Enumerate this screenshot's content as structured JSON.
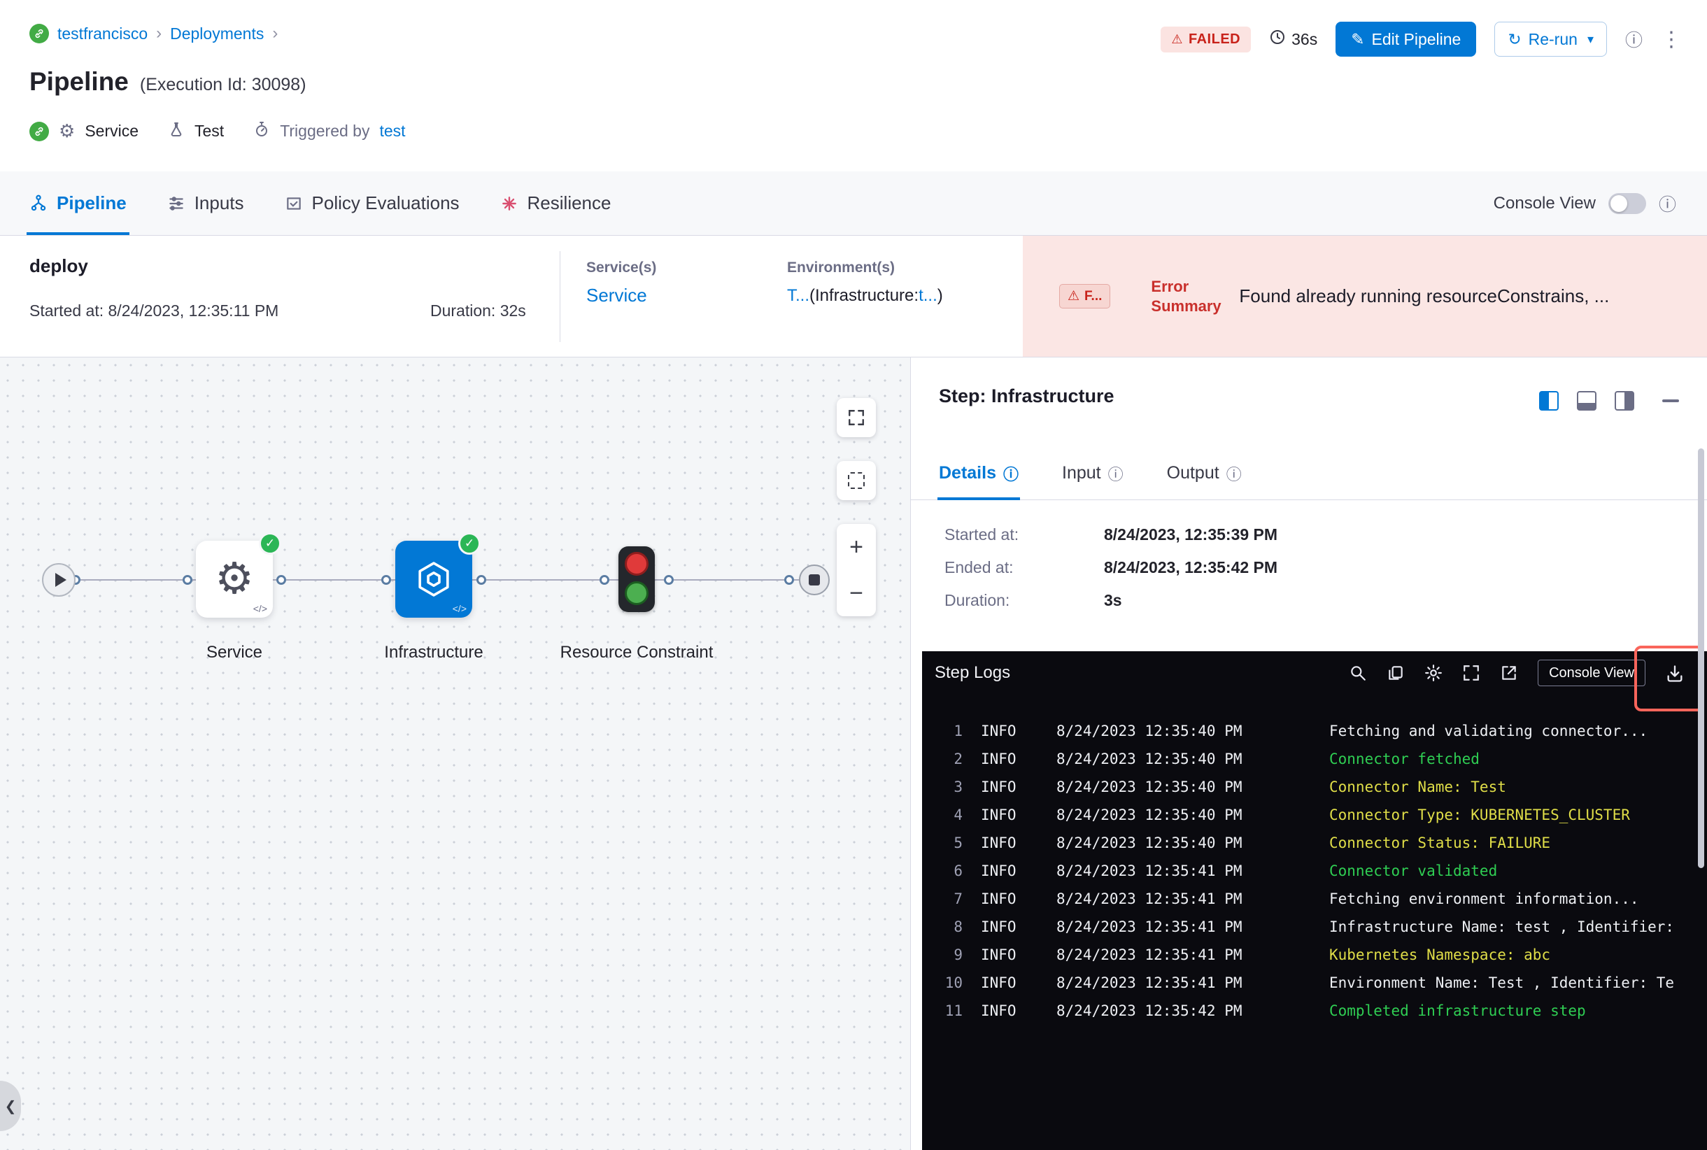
{
  "glyphs": {
    "chevron_sep": "›",
    "gear": "⚙",
    "kebab": "⋮",
    "info": "ⓘ",
    "warning": "⚠",
    "check": "✓",
    "caret_down": "▾",
    "pencil": "✎",
    "refresh": "↻",
    "code": "</>",
    "plus": "+",
    "minus": "−",
    "collapse": "❮"
  },
  "header": {
    "breadcrumb": [
      "testfrancisco",
      "Deployments"
    ],
    "title": "Pipeline",
    "execution_id": "(Execution Id: 30098)",
    "meta": {
      "service_label": "Service",
      "test_label": "Test",
      "triggered_label": "Triggered by",
      "triggered_value": "test"
    },
    "actions": {
      "status_badge": "FAILED",
      "elapsed": "36s",
      "edit_button": "Edit Pipeline",
      "rerun_button": "Re-run"
    }
  },
  "tabbar": {
    "tabs": [
      {
        "label": "Pipeline"
      },
      {
        "label": "Inputs"
      },
      {
        "label": "Policy Evaluations"
      },
      {
        "label": "Resilience"
      }
    ],
    "console_view_label": "Console View"
  },
  "summary": {
    "stage": "deploy",
    "started_label": "Started at:",
    "started_value": "8/24/2023, 12:35:11 PM",
    "duration_label": "Duration:",
    "duration_value": "32s",
    "services_label": "Service(s)",
    "services_value": "Service",
    "environments_label": "Environment(s)",
    "environments_value": "T...",
    "environments_paren_open": "(Infrastructure:",
    "environments_link": "t...",
    "environments_paren_close": ")",
    "error": {
      "badge": "F...",
      "label": "Error Summary",
      "message": "Found already running resourceConstrains, ..."
    }
  },
  "canvas": {
    "nodes": [
      {
        "label": "Service"
      },
      {
        "label": "Infrastructure"
      },
      {
        "label": "Resource Constraint"
      }
    ]
  },
  "panel": {
    "title": "Step: Infrastructure",
    "tabs": [
      {
        "label": "Details"
      },
      {
        "label": "Input"
      },
      {
        "label": "Output"
      }
    ],
    "details": {
      "rows": [
        {
          "label": "Started at:",
          "value": "8/24/2023, 12:35:39 PM"
        },
        {
          "label": "Ended at:",
          "value": "8/24/2023, 12:35:42 PM"
        },
        {
          "label": "Duration:",
          "value": "3s"
        }
      ]
    },
    "logs": {
      "title": "Step Logs",
      "console_view_button": "Console View",
      "lines": [
        {
          "num": "1",
          "level": "INFO",
          "time": "8/24/2023 12:35:40 PM",
          "text": "Fetching and validating connector...",
          "color": "white"
        },
        {
          "num": "2",
          "level": "INFO",
          "time": "8/24/2023 12:35:40 PM",
          "text": "Connector fetched",
          "color": "green"
        },
        {
          "num": "3",
          "level": "INFO",
          "time": "8/24/2023 12:35:40 PM",
          "text": "Connector Name: Test",
          "color": "yellow"
        },
        {
          "num": "4",
          "level": "INFO",
          "time": "8/24/2023 12:35:40 PM",
          "text": "Connector Type: KUBERNETES_CLUSTER",
          "color": "yellow"
        },
        {
          "num": "5",
          "level": "INFO",
          "time": "8/24/2023 12:35:40 PM",
          "text": "Connector Status: FAILURE",
          "color": "yellow"
        },
        {
          "num": "6",
          "level": "INFO",
          "time": "8/24/2023 12:35:41 PM",
          "text": "Connector validated",
          "color": "green"
        },
        {
          "num": "7",
          "level": "INFO",
          "time": "8/24/2023 12:35:41 PM",
          "text": "Fetching environment information...",
          "color": "white"
        },
        {
          "num": "8",
          "level": "INFO",
          "time": "8/24/2023 12:35:41 PM",
          "text": "Infrastructure Name: test , Identifier:",
          "color": "white"
        },
        {
          "num": "9",
          "level": "INFO",
          "time": "8/24/2023 12:35:41 PM",
          "text": "Kubernetes Namespace: abc",
          "color": "yellow"
        },
        {
          "num": "10",
          "level": "INFO",
          "time": "8/24/2023 12:35:41 PM",
          "text": "Environment Name: Test , Identifier: Te",
          "color": "white"
        },
        {
          "num": "11",
          "level": "INFO",
          "time": "8/24/2023 12:35:42 PM",
          "text": "Completed infrastructure step",
          "color": "green"
        }
      ]
    }
  }
}
